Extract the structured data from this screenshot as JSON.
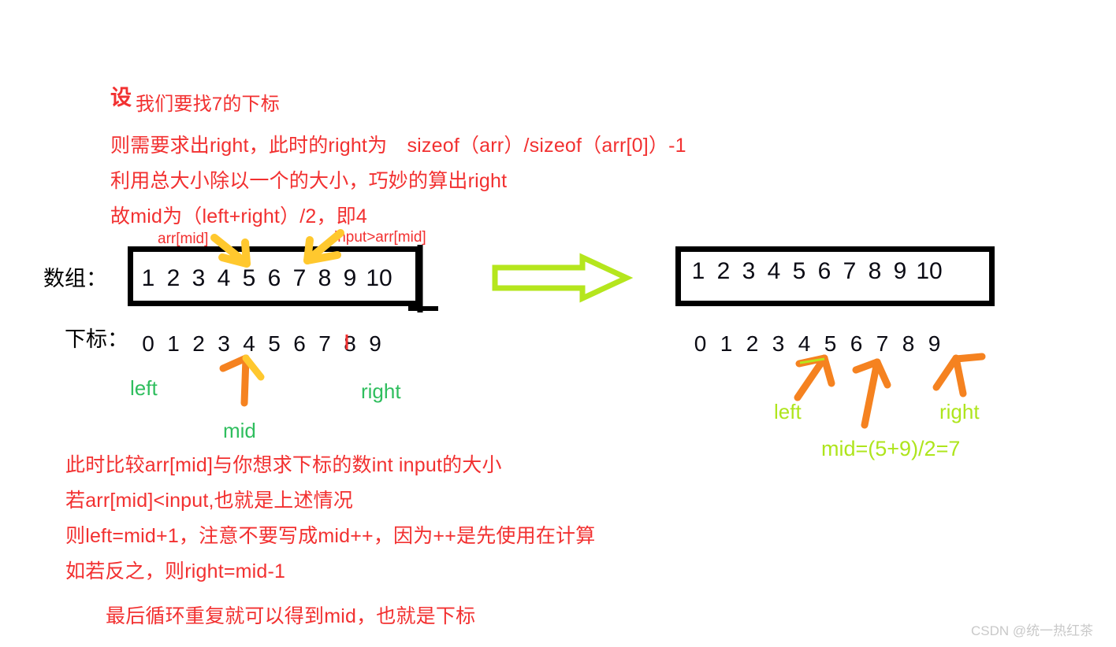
{
  "page": {
    "background": "#ffffff",
    "watermark": "CSDN @统一热红茶"
  },
  "colors": {
    "red_text": "#f23030",
    "black": "#000000",
    "green_marker": "#2fbe5e",
    "lime_marker": "#aee51c",
    "orange_arrow": "#f58220",
    "yellow_arrow": "#ffc800",
    "lime_arrow": "#b5e61d",
    "watermark_gray": "#c9c9c9"
  },
  "intro": {
    "lead_char": "设",
    "lines": [
      "我们要找7的下标",
      "则需要求出right，此时的right为　sizeof（arr）/sizeof（arr[0]）-1",
      "利用总大小除以一个的大小，巧妙的算出right",
      "故mid为（left+right）/2，即4"
    ]
  },
  "left_diagram": {
    "row_label": "数组：",
    "array_values": [
      "1",
      "2",
      "3",
      "4",
      "5",
      "6",
      "7",
      "8",
      "9",
      "10"
    ],
    "index_label": "下标：",
    "index_values": [
      "0",
      "1",
      "2",
      "3",
      "4",
      "5",
      "6",
      "7",
      "8",
      "9"
    ],
    "annotations": {
      "arr_mid": "arr[mid]",
      "input_gt": "input>arr[mid]"
    },
    "markers": {
      "left": "left",
      "mid": "mid",
      "right": "right"
    }
  },
  "right_diagram": {
    "array_values": [
      "1",
      "2",
      "3",
      "4",
      "5",
      "6",
      "7",
      "8",
      "9",
      "10"
    ],
    "index_values": [
      "0",
      "1",
      "2",
      "3",
      "4",
      "5",
      "6",
      "7",
      "8",
      "9"
    ],
    "markers": {
      "left": "left",
      "right": "right",
      "mid_formula": "mid=(5+9)/2=7"
    }
  },
  "transition": {
    "arrow": "right-block-arrow"
  },
  "conclusion": {
    "lines": [
      "此时比较arr[mid]与你想求下标的数int input的大小",
      "若arr[mid]<input,也就是上述情况",
      "则left=mid+1，注意不要写成mid++，因为++是先使用在计算",
      "如若反之，则right=mid-1"
    ],
    "final_line": "最后循环重复就可以得到mid，也就是下标"
  }
}
